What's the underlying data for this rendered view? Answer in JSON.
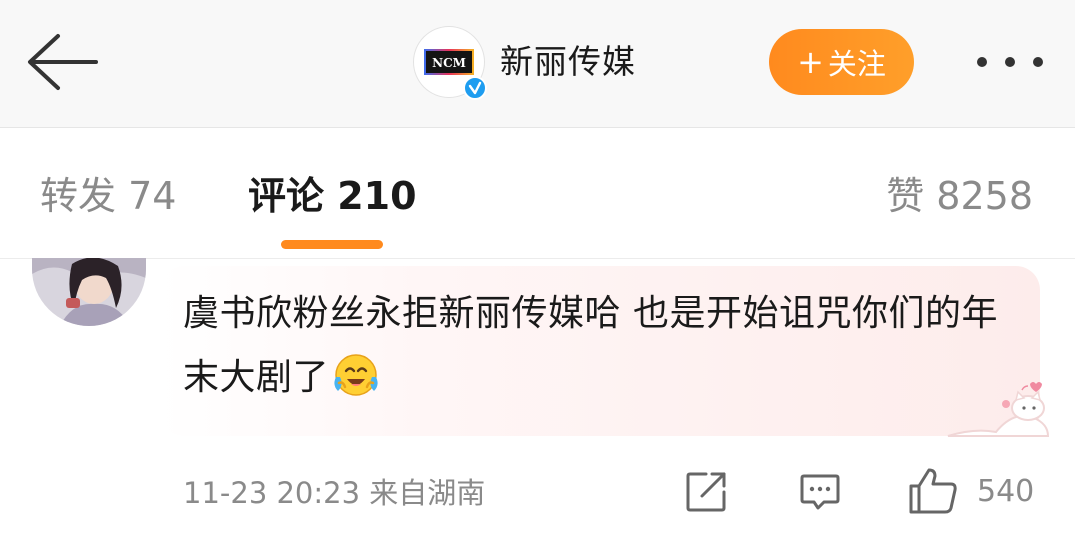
{
  "header": {
    "account_name": "新丽传媒",
    "logo_text": "NCM",
    "follow_label": "关注",
    "follow_plus": "+",
    "colors": {
      "follow": "#ff8a1e",
      "verified": "#1e9df0"
    }
  },
  "tabs": {
    "repost": "转发 74",
    "comments": "评论 210",
    "likes": "赞 8258",
    "active": "comments",
    "indicator_color": "#ff8a1e"
  },
  "comment": {
    "text": "虞书欣粉丝永拒新丽传媒哈 也是开始诅咒你们的年末大剧了",
    "emoji": "crying-laughing-emoji",
    "timestamp": "11-23 20:23",
    "location": "来自湖南",
    "meta": "11-23 20:23  来自湖南",
    "like_count": "540"
  },
  "icons": {
    "back": "back-arrow-icon",
    "more": "more-icon",
    "verified": "verified-icon",
    "share": "share-icon",
    "reply": "comment-icon",
    "like": "thumbs-up-icon"
  }
}
